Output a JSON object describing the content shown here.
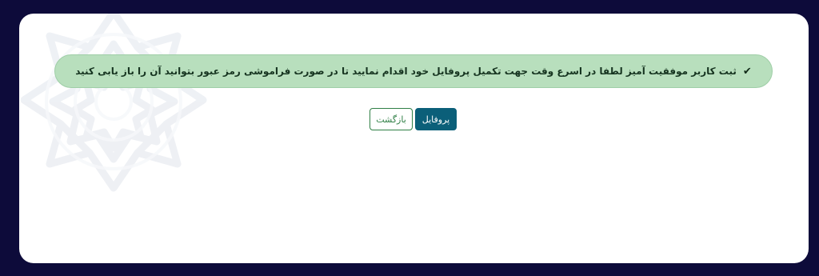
{
  "alert": {
    "message": "ثبت کاربر موفقیت آمیز لطفا در اسرع وقت جهت تکمیل پروفایل خود اقدام نمایید تا در صورت فراموشی رمز عبور بتوانید آن را باز یابی کنید",
    "icon": "check-icon",
    "colors": {
      "background": "#b8dfbd",
      "border": "#9fcea7",
      "text": "#163420"
    }
  },
  "actions": {
    "back_label": "بازگشت",
    "profile_label": "پروفایل",
    "colors": {
      "back": "#2f7f45",
      "profile": "#0b5f79"
    }
  },
  "theme": {
    "page_background": "#0d0b3a",
    "card_background": "#ffffff"
  }
}
